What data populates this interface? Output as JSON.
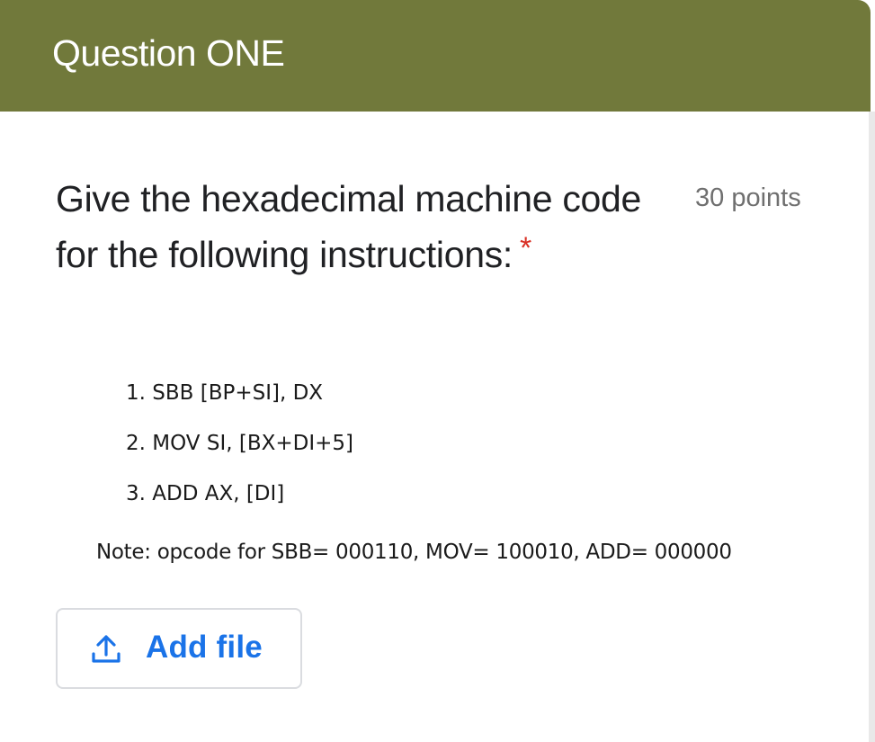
{
  "header": {
    "title": "Question ONE"
  },
  "question": {
    "text": "Give the hexadecimal machine code for the following instructions:",
    "points": "30 points",
    "required_marker": "*"
  },
  "instructions": [
    "1. SBB [BP+SI], DX",
    "2. MOV SI, [BX+DI+5]",
    "3. ADD AX, [DI]"
  ],
  "note": "Note: opcode for SBB= 000110, MOV= 100010, ADD= 000000",
  "upload": {
    "label": "Add file",
    "icon": "upload-icon"
  },
  "colors": {
    "header_bg": "#71793b",
    "accent": "#1a73e8",
    "required": "#d93025"
  }
}
